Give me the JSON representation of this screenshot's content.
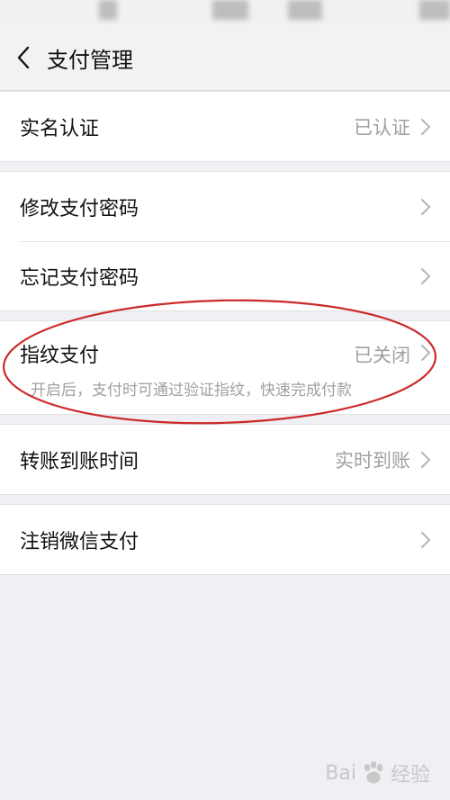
{
  "header": {
    "title": "支付管理"
  },
  "rows": {
    "real_name": {
      "label": "实名认证",
      "value": "已认证"
    },
    "change_pwd": {
      "label": "修改支付密码"
    },
    "forgot_pwd": {
      "label": "忘记支付密码"
    },
    "fingerprint": {
      "label": "指纹支付",
      "value": "已关闭",
      "desc": "开启后，支付时可通过验证指纹，快速完成付款"
    },
    "transfer_time": {
      "label": "转账到账时间",
      "value": "实时到账"
    },
    "close_wechat_pay": {
      "label": "注销微信支付"
    }
  },
  "watermark": {
    "text_left": "Bai",
    "text_right": "经验"
  },
  "colors": {
    "annotation": "#cc2a2a",
    "background": "#efeff4",
    "secondary_text": "#a0a0a0"
  }
}
